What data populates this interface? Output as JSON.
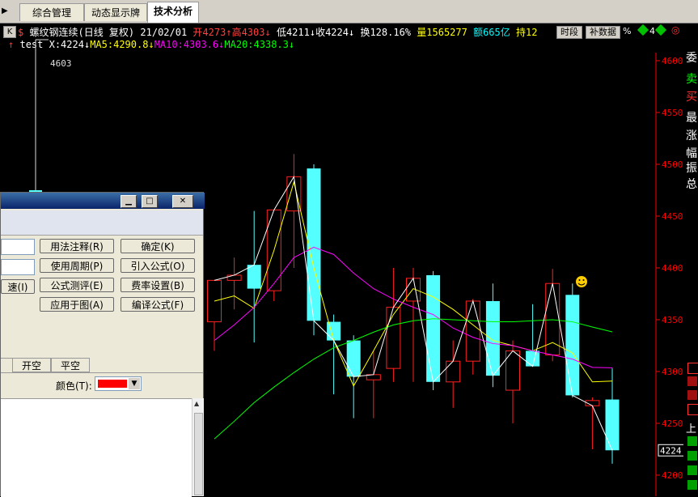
{
  "tabs": [
    {
      "label": "综合管理"
    },
    {
      "label": "动态显示牌"
    },
    {
      "label": "技术分析"
    }
  ],
  "header": {
    "k_label": "K",
    "symbol": "$",
    "title": "螺纹钢连续(日线 复权)",
    "date": "21/02/01",
    "open": "开4273",
    "high": "高4303",
    "low": "低4211",
    "close": "收4224",
    "turnover": "换128.16%",
    "volume": "量1565277",
    "amount": "额665亿",
    "hold": "持12",
    "btn_time": "时段",
    "btn_fill": "补数据",
    "btn_tail": "%",
    "tail_digit": "4"
  },
  "indicators": {
    "name": "test",
    "x_label": "X:4224",
    "ma5": "MA5:4290.8",
    "ma10": "MA10:4303.6",
    "ma20": "MA20:4338.3"
  },
  "peak_label": "4603",
  "price_axis": {
    "ticks": [
      "4600",
      "4550",
      "4500",
      "4450",
      "4400",
      "4350",
      "4300",
      "4250",
      "4200"
    ],
    "current": "4224"
  },
  "right_labels": [
    "委",
    "卖",
    "买",
    "最",
    "涨",
    "幅",
    "振",
    "总",
    "上"
  ],
  "chart_data": {
    "type": "candlestick",
    "ylim": [
      4180,
      4620
    ],
    "candles": [
      {
        "open": 4348,
        "high": 4360,
        "low": 4320,
        "close": 4388,
        "up": true
      },
      {
        "open": 4388,
        "high": 4410,
        "low": 4360,
        "close": 4393,
        "up": true
      },
      {
        "open": 4380,
        "high": 4455,
        "low": 4328,
        "close": 4403,
        "up": false
      },
      {
        "open": 4378,
        "high": 4432,
        "low": 4368,
        "close": 4456,
        "up": true
      },
      {
        "open": 4455,
        "high": 4510,
        "low": 4400,
        "close": 4488,
        "up": true
      },
      {
        "open": 4496,
        "high": 4500,
        "low": 4335,
        "close": 4349,
        "up": false
      },
      {
        "open": 4348,
        "high": 4355,
        "low": 4278,
        "close": 4330,
        "up": false
      },
      {
        "open": 4330,
        "high": 4335,
        "low": 4255,
        "close": 4295,
        "up": false
      },
      {
        "open": 4292,
        "high": 4320,
        "low": 4255,
        "close": 4297,
        "up": true
      },
      {
        "open": 4303,
        "high": 4400,
        "low": 4290,
        "close": 4362,
        "up": true
      },
      {
        "open": 4368,
        "high": 4400,
        "low": 4290,
        "close": 4390,
        "up": true
      },
      {
        "open": 4393,
        "high": 4397,
        "low": 4282,
        "close": 4290,
        "up": false
      },
      {
        "open": 4290,
        "high": 4330,
        "low": 4265,
        "close": 4310,
        "up": true
      },
      {
        "open": 4310,
        "high": 4370,
        "low": 4297,
        "close": 4368,
        "up": true
      },
      {
        "open": 4368,
        "high": 4385,
        "low": 4285,
        "close": 4296,
        "up": false
      },
      {
        "open": 4282,
        "high": 4330,
        "low": 4250,
        "close": 4320,
        "up": true
      },
      {
        "open": 4320,
        "high": 4365,
        "low": 4305,
        "close": 4305,
        "up": false
      },
      {
        "open": 4316,
        "high": 4399,
        "low": 4310,
        "close": 4385,
        "up": true
      },
      {
        "open": 4374,
        "high": 4385,
        "low": 4275,
        "close": 4277,
        "up": false
      },
      {
        "open": 4272,
        "high": 4275,
        "low": 4225,
        "close": 4267,
        "up": true
      },
      {
        "open": 4273,
        "high": 4303,
        "low": 4211,
        "close": 4224,
        "up": false
      }
    ],
    "ma5": [
      4368,
      4373,
      4361,
      4417,
      4483,
      4400,
      4330,
      4286,
      4320,
      4355,
      4380,
      4372,
      4360,
      4345,
      4330,
      4325,
      4320,
      4328,
      4318,
      4290,
      4290.8
    ],
    "ma10": [
      4330,
      4345,
      4362,
      4385,
      4410,
      4420,
      4413,
      4395,
      4380,
      4370,
      4362,
      4355,
      4342,
      4333,
      4327,
      4325,
      4320,
      4316,
      4312,
      4304,
      4303.6
    ],
    "ma20": [
      4235,
      4252,
      4270,
      4285,
      4299,
      4312,
      4323,
      4330,
      4338,
      4345,
      4349,
      4351,
      4350,
      4349,
      4348,
      4348,
      4349,
      4350,
      4348,
      4343,
      4338.3
    ],
    "x_labels": [],
    "title": ""
  },
  "dialog": {
    "btn_usage": "用法注释(R)",
    "btn_ok": "确定(K)",
    "btn_period": "使用周期(P)",
    "btn_import": "引入公式(O)",
    "btn_speed": "速(I)",
    "btn_test": "公式测评(E)",
    "btn_fee": "费率设置(B)",
    "btn_apply": "应用于图(A)",
    "btn_compile": "编译公式(F)",
    "tab_open_short": "开空",
    "tab_close_short": "平空",
    "color_label": "颜色(T):",
    "color_value": "#ff0000"
  },
  "colors": {
    "up": "#ff2020",
    "down": "#54ffff",
    "ma5": "#ffff00",
    "ma10": "#ff00ff",
    "ma20": "#00ff00",
    "axis": "#ff0000"
  }
}
